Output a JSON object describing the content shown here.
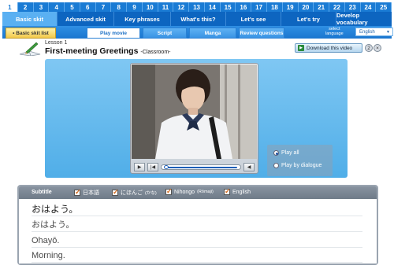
{
  "lessons": [
    "1",
    "2",
    "3",
    "4",
    "5",
    "6",
    "7",
    "8",
    "9",
    "10",
    "11",
    "12",
    "13",
    "14",
    "15",
    "16",
    "17",
    "18",
    "19",
    "20",
    "21",
    "22",
    "23",
    "24",
    "25"
  ],
  "active_lesson": "1",
  "sections": [
    {
      "label": "Basic skit",
      "active": true
    },
    {
      "label": "Advanced skit",
      "active": false
    },
    {
      "label": "Key phrases",
      "active": false
    },
    {
      "label": "What's this?",
      "active": false
    },
    {
      "label": "Let's see",
      "active": false
    },
    {
      "label": "Let's try",
      "active": false
    },
    {
      "label": "Develop vocabulary",
      "active": false
    }
  ],
  "subtabs": {
    "list": "• Basic skit list",
    "play_movie": "Play movie",
    "script": "Script",
    "manga": "Manga",
    "review": "Review questions"
  },
  "language": {
    "label_line1": "select",
    "label_line2": "language",
    "value": "English"
  },
  "lesson": {
    "number": "Lesson 1",
    "title": "First-meeting Greetings",
    "subtitle": "-Classroom-"
  },
  "download_label": "Download this video",
  "help_buttons": [
    "2",
    "×"
  ],
  "player": {
    "controls": {
      "play": "▶",
      "prev": "|◀",
      "volume": "◀"
    },
    "progress": 0.02
  },
  "play_options": {
    "all": "Play all",
    "by_dialogue": "Play by dialogue",
    "selected": "all"
  },
  "subtitles": {
    "label": "Subtitle",
    "options": {
      "nihongo": "日本語",
      "kana": "にほんご",
      "kana_note": "(かな)",
      "romaji": "Nihongo",
      "romaji_note": "(Rōmaji)",
      "english": "English"
    },
    "lines": [
      "おはよう。",
      "おはよう。",
      "Ohayō.",
      "Morning."
    ]
  },
  "colors": {
    "bar_blue": "#1a7bd4",
    "stage_blue": "#50aee8",
    "accent_yellow": "#f3c94a"
  }
}
